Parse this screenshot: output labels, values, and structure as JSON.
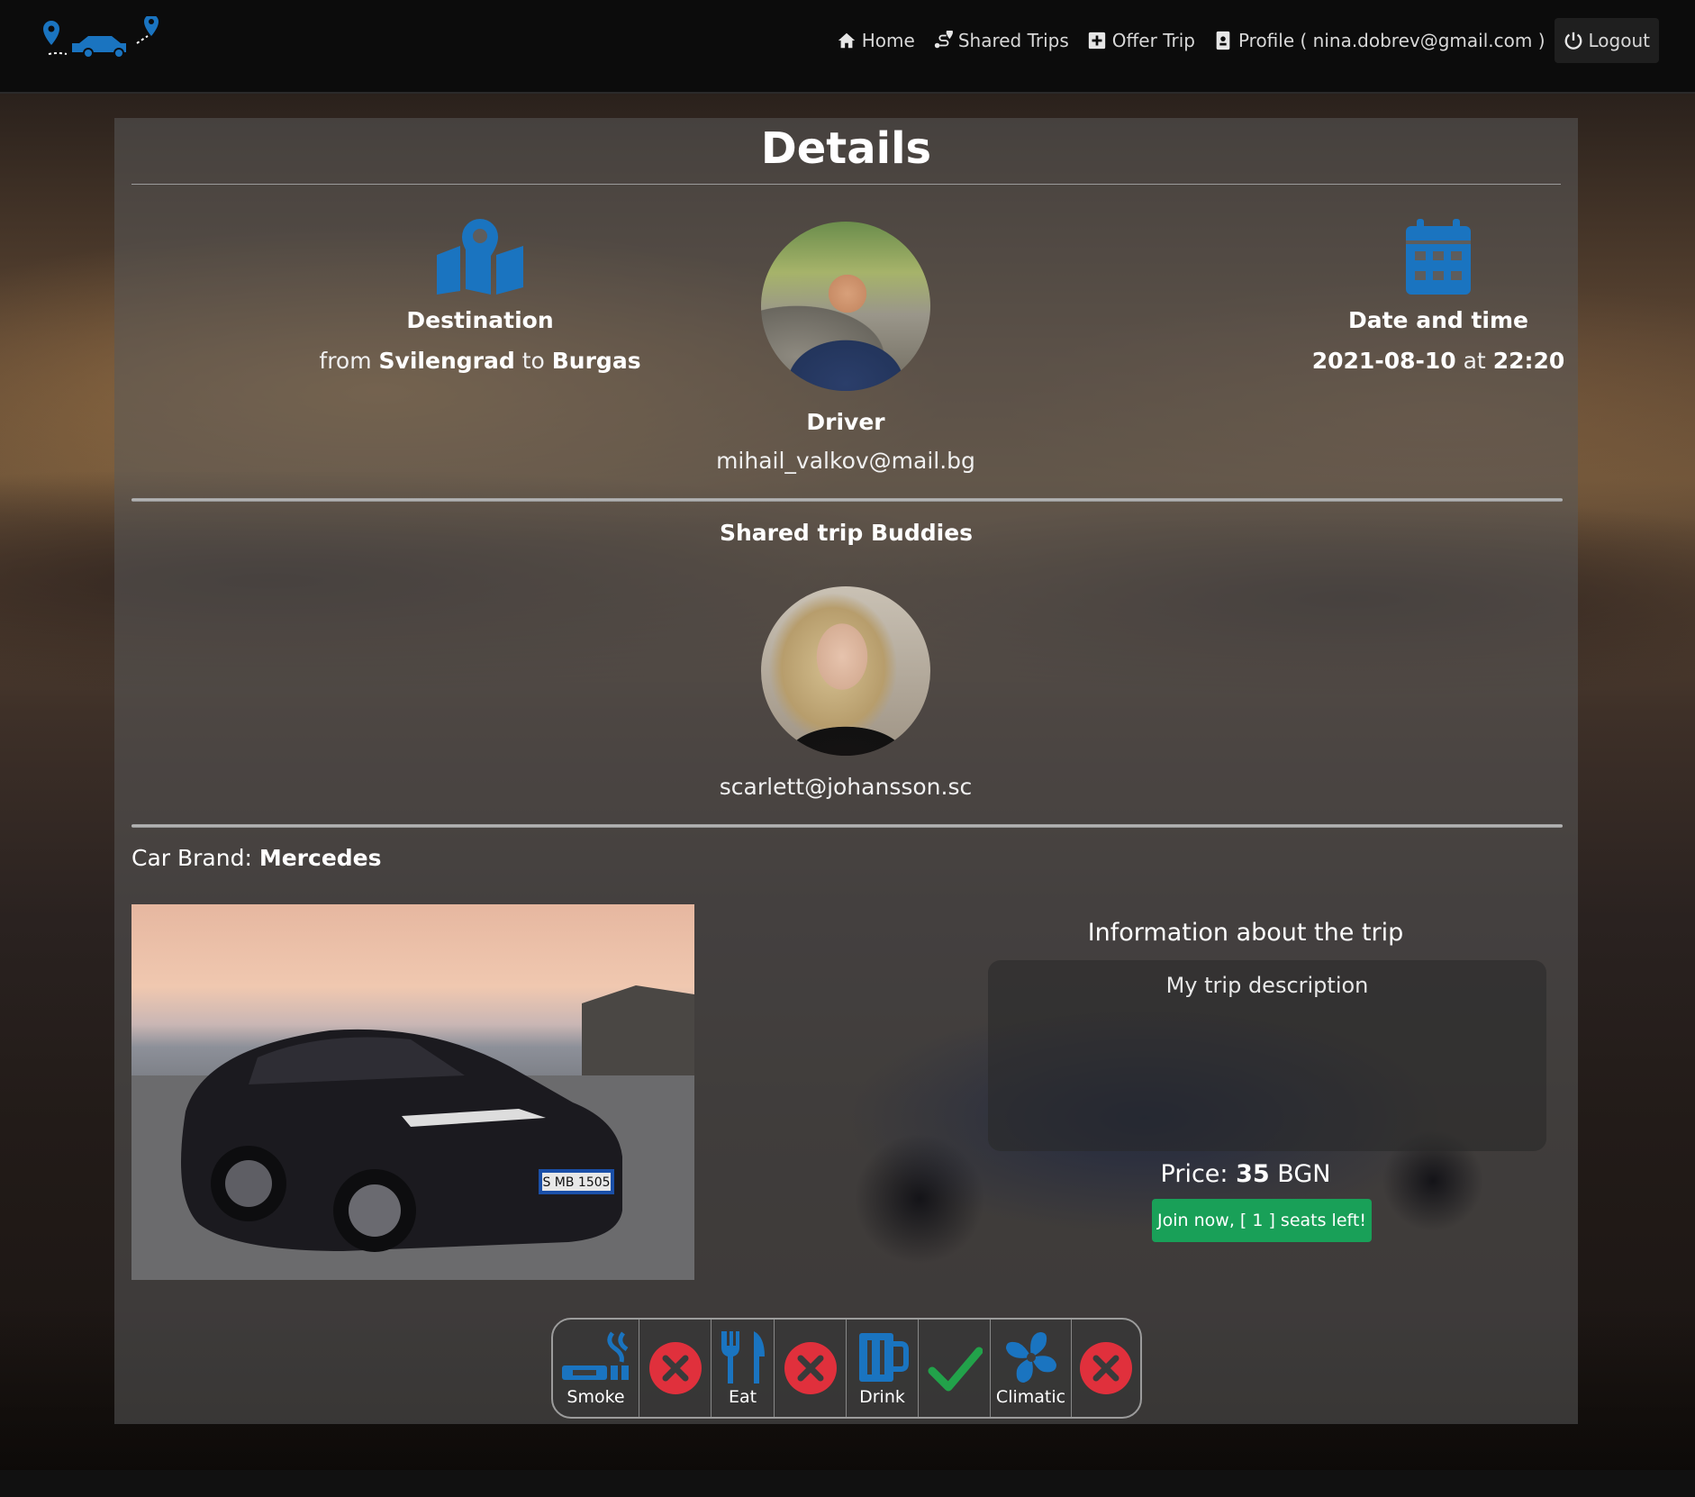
{
  "nav": {
    "items": [
      {
        "label": "Home",
        "icon": "home-icon"
      },
      {
        "label": "Shared Trips",
        "icon": "route-icon"
      },
      {
        "label": "Offer Trip",
        "icon": "plus-square-icon"
      },
      {
        "label": "Profile ( nina.dobrev@gmail.com )",
        "icon": "id-card-icon"
      },
      {
        "label": "Logout",
        "icon": "power-icon"
      }
    ]
  },
  "colors": {
    "accent": "#1a74c0",
    "join_button": "#19a058",
    "not_allowed": "#e0303c",
    "allowed": "#22a24a"
  },
  "details": {
    "title": "Details",
    "destination": {
      "heading": "Destination",
      "from_word": "from",
      "from_city": "Svilengrad",
      "to_word": "to",
      "to_city": "Burgas"
    },
    "driver": {
      "heading": "Driver",
      "email": "mihail_valkov@mail.bg"
    },
    "datetime": {
      "heading": "Date and time",
      "date": "2021-08-10",
      "at_word": "at",
      "time": "22:20"
    },
    "buddies": {
      "heading": "Shared trip Buddies",
      "list": [
        {
          "email": "scarlett@johansson.sc"
        }
      ]
    },
    "car": {
      "brand_label": "Car Brand:",
      "brand": "Mercedes",
      "plate": "S MB 1505"
    },
    "trip_info": {
      "heading": "Information about the trip",
      "description": "My trip description",
      "price_label": "Price:",
      "price_value": "35",
      "currency": "BGN",
      "join_label": "Join now, [ 1 ] seats left!"
    },
    "amenities": [
      {
        "label": "Smoke",
        "icon": "smoking-icon",
        "allowed": false
      },
      {
        "label": "Eat",
        "icon": "utensils-icon",
        "allowed": false
      },
      {
        "label": "Drink",
        "icon": "beer-icon",
        "allowed": true
      },
      {
        "label": "Climatic",
        "icon": "fan-icon",
        "allowed": false
      }
    ]
  }
}
